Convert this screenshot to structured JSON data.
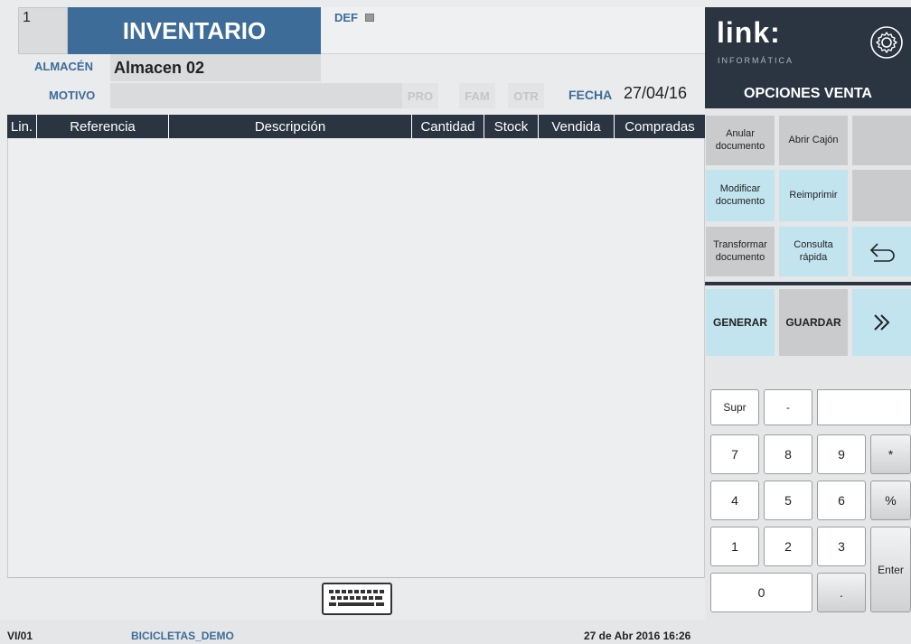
{
  "header": {
    "doc_number": "1",
    "title": "INVENTARIO",
    "def_label": "DEF",
    "almacen_label": "ALMACÉN",
    "almacen_value": "Almacen 02",
    "motivo_label": "MOTIVO",
    "chips": [
      "PRO",
      "FAM",
      "OTR"
    ],
    "fecha_label": "FECHA",
    "fecha_value": "27/04/16"
  },
  "table": {
    "columns": [
      "Lin.",
      "Referencia",
      "Descripción",
      "Cantidad",
      "Stock",
      "Vendida",
      "Compradas"
    ],
    "rows": []
  },
  "footer": {
    "user": "VI/01",
    "company": "BICICLETAS_DEMO",
    "datetime": "27 de Abr 2016 16:26"
  },
  "brand": {
    "name": "link:",
    "subtitle": "INFORMÁTICA"
  },
  "panel": {
    "title": "OPCIONES VENTA",
    "anular": "Anular documento",
    "abrir_cajon": "Abrir Cajón",
    "modificar": "Modificar documento",
    "reimprimir": "Reimprimir",
    "transformar": "Transformar documento",
    "consulta": "Consulta rápida",
    "generar": "GENERAR",
    "guardar": "GUARDAR",
    "next_icon": "double-chevron-right-icon",
    "back_icon": "return-arrow-icon"
  },
  "numpad": {
    "supr": "Supr",
    "minus": "-",
    "display": "",
    "k7": "7",
    "k8": "8",
    "k9": "9",
    "mult": "*",
    "k4": "4",
    "k5": "5",
    "k6": "6",
    "pct": "%",
    "k1": "1",
    "k2": "2",
    "k3": "3",
    "enter": "Enter",
    "k0": "0",
    "dot": "."
  },
  "colors": {
    "title_bg": "#3d6c99",
    "dark_bg": "#2a3541",
    "cyan_button": "#c2e4ef",
    "gray_button": "#c9cbcd"
  }
}
